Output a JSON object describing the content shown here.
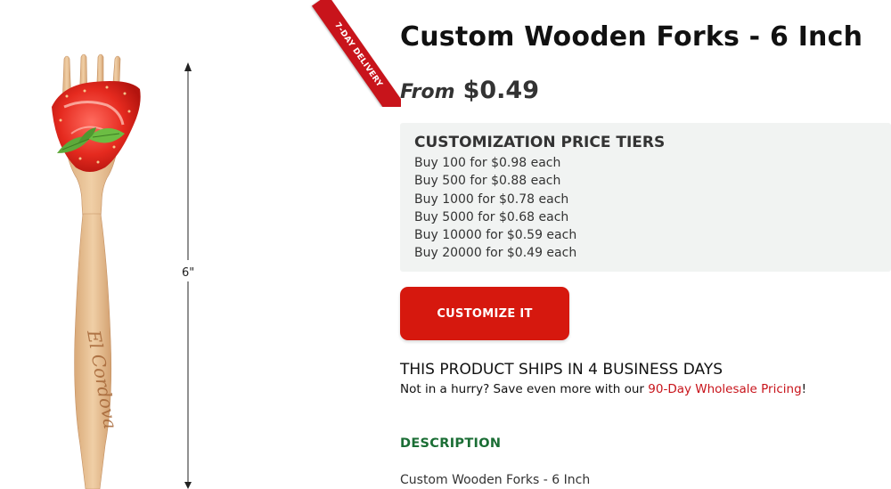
{
  "ribbon": {
    "text": "7-DAY DELIVERY"
  },
  "image": {
    "dimension_label": "6\"",
    "brand_engraving": "El Cordova"
  },
  "product": {
    "title": "Custom Wooden Forks - 6 Inch",
    "price_prefix": "From",
    "price": "$0.49"
  },
  "tiers": {
    "heading": "CUSTOMIZATION PRICE TIERS",
    "rows": [
      "Buy 100 for $0.98 each",
      "Buy 500 for $0.88 each",
      "Buy 1000 for $0.78 each",
      "Buy 5000 for $0.68 each",
      "Buy 10000 for $0.59 each",
      "Buy 20000 for $0.49 each"
    ]
  },
  "cta": {
    "label": "CUSTOMIZE IT"
  },
  "shipping": {
    "heading": "THIS PRODUCT SHIPS IN 4 BUSINESS DAYS",
    "note_before": "Not in a hurry? Save even more with our ",
    "note_link": "90-Day Wholesale Pricing",
    "note_after": "!"
  },
  "description": {
    "heading": "DESCRIPTION",
    "text": "Custom Wooden Forks - 6 Inch"
  },
  "colors": {
    "accent_red": "#d6180e",
    "description_green": "#1b6e35",
    "tier_box_bg": "#f1f3f2"
  }
}
